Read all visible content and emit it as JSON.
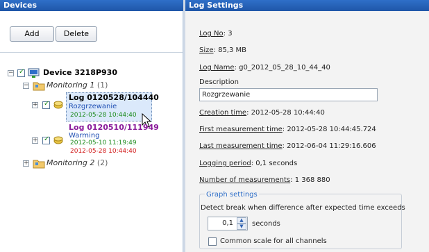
{
  "left": {
    "title": "Devices",
    "add_label": "Add",
    "delete_label": "Delete",
    "device": {
      "name": "Device 3218P930"
    },
    "monitor1": {
      "name": "Monitoring 1",
      "count": "(1)"
    },
    "log1": {
      "id": "Log 0120528/104440",
      "desc": "Rozgrzewanie",
      "time": "2012-05-28 10:44:40"
    },
    "log2": {
      "id": "Log 0120510/111949",
      "desc": "Warming",
      "time_start": "2012-05-10 11:19:49",
      "time_end": "2012-05-28 10:44:40"
    },
    "monitor2": {
      "name": "Monitoring 2",
      "count": "(2)"
    }
  },
  "right": {
    "title": "Log Settings",
    "log_no": {
      "label": "Log No",
      "value": ": 3"
    },
    "size": {
      "label": "Size",
      "value": ": 85,3 MB"
    },
    "log_name": {
      "label": "Log Name",
      "value": ": g0_2012_05_28_10_44_40"
    },
    "description_label": "Description",
    "description_value": "Rozgrzewanie",
    "creation_time": {
      "label": "Creation time",
      "value": ": 2012-05-28 10:44:40"
    },
    "first_measurement": {
      "label": "First measurement time",
      "value": ": 2012-05-28 10:44:45.724"
    },
    "last_measurement": {
      "label": "Last measurement time",
      "value": ": 2012-06-04 11:29:16.606"
    },
    "logging_period": {
      "label": "Logging period",
      "value": ": 0,1 seconds"
    },
    "num_measurements": {
      "label": "Number of measurements",
      "value": ": 1 368 880"
    },
    "graph": {
      "legend": "Graph settings",
      "detect_label": "Detect break when difference after expected time exceeds",
      "spin_value": "0,1",
      "seconds_label": "seconds",
      "common_scale_label": "Common scale for all channels"
    }
  },
  "colors": {
    "header": "#2f6fc8",
    "log1_id": "#000000",
    "log1_desc": "#1f4fb3",
    "log1_time": "#1b8a1b",
    "log2_id": "#8a1a9a",
    "log2_desc": "#1f4fb3",
    "log2_start": "#1b8a1b",
    "log2_end": "#d21c1c"
  }
}
